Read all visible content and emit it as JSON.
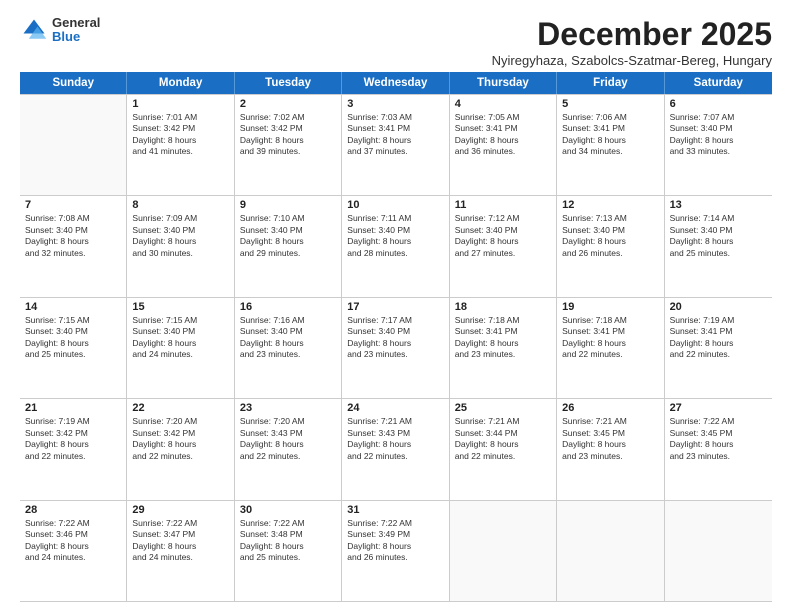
{
  "header": {
    "logo": {
      "general": "General",
      "blue": "Blue"
    },
    "title": "December 2025",
    "subtitle": "Nyiregyhaza, Szabolcs-Szatmar-Bereg, Hungary"
  },
  "weekdays": [
    "Sunday",
    "Monday",
    "Tuesday",
    "Wednesday",
    "Thursday",
    "Friday",
    "Saturday"
  ],
  "weeks": [
    [
      {
        "day": "",
        "lines": [],
        "empty": true
      },
      {
        "day": "1",
        "lines": [
          "Sunrise: 7:01 AM",
          "Sunset: 3:42 PM",
          "Daylight: 8 hours",
          "and 41 minutes."
        ],
        "empty": false
      },
      {
        "day": "2",
        "lines": [
          "Sunrise: 7:02 AM",
          "Sunset: 3:42 PM",
          "Daylight: 8 hours",
          "and 39 minutes."
        ],
        "empty": false
      },
      {
        "day": "3",
        "lines": [
          "Sunrise: 7:03 AM",
          "Sunset: 3:41 PM",
          "Daylight: 8 hours",
          "and 37 minutes."
        ],
        "empty": false
      },
      {
        "day": "4",
        "lines": [
          "Sunrise: 7:05 AM",
          "Sunset: 3:41 PM",
          "Daylight: 8 hours",
          "and 36 minutes."
        ],
        "empty": false
      },
      {
        "day": "5",
        "lines": [
          "Sunrise: 7:06 AM",
          "Sunset: 3:41 PM",
          "Daylight: 8 hours",
          "and 34 minutes."
        ],
        "empty": false
      },
      {
        "day": "6",
        "lines": [
          "Sunrise: 7:07 AM",
          "Sunset: 3:40 PM",
          "Daylight: 8 hours",
          "and 33 minutes."
        ],
        "empty": false
      }
    ],
    [
      {
        "day": "7",
        "lines": [
          "Sunrise: 7:08 AM",
          "Sunset: 3:40 PM",
          "Daylight: 8 hours",
          "and 32 minutes."
        ],
        "empty": false
      },
      {
        "day": "8",
        "lines": [
          "Sunrise: 7:09 AM",
          "Sunset: 3:40 PM",
          "Daylight: 8 hours",
          "and 30 minutes."
        ],
        "empty": false
      },
      {
        "day": "9",
        "lines": [
          "Sunrise: 7:10 AM",
          "Sunset: 3:40 PM",
          "Daylight: 8 hours",
          "and 29 minutes."
        ],
        "empty": false
      },
      {
        "day": "10",
        "lines": [
          "Sunrise: 7:11 AM",
          "Sunset: 3:40 PM",
          "Daylight: 8 hours",
          "and 28 minutes."
        ],
        "empty": false
      },
      {
        "day": "11",
        "lines": [
          "Sunrise: 7:12 AM",
          "Sunset: 3:40 PM",
          "Daylight: 8 hours",
          "and 27 minutes."
        ],
        "empty": false
      },
      {
        "day": "12",
        "lines": [
          "Sunrise: 7:13 AM",
          "Sunset: 3:40 PM",
          "Daylight: 8 hours",
          "and 26 minutes."
        ],
        "empty": false
      },
      {
        "day": "13",
        "lines": [
          "Sunrise: 7:14 AM",
          "Sunset: 3:40 PM",
          "Daylight: 8 hours",
          "and 25 minutes."
        ],
        "empty": false
      }
    ],
    [
      {
        "day": "14",
        "lines": [
          "Sunrise: 7:15 AM",
          "Sunset: 3:40 PM",
          "Daylight: 8 hours",
          "and 25 minutes."
        ],
        "empty": false
      },
      {
        "day": "15",
        "lines": [
          "Sunrise: 7:15 AM",
          "Sunset: 3:40 PM",
          "Daylight: 8 hours",
          "and 24 minutes."
        ],
        "empty": false
      },
      {
        "day": "16",
        "lines": [
          "Sunrise: 7:16 AM",
          "Sunset: 3:40 PM",
          "Daylight: 8 hours",
          "and 23 minutes."
        ],
        "empty": false
      },
      {
        "day": "17",
        "lines": [
          "Sunrise: 7:17 AM",
          "Sunset: 3:40 PM",
          "Daylight: 8 hours",
          "and 23 minutes."
        ],
        "empty": false
      },
      {
        "day": "18",
        "lines": [
          "Sunrise: 7:18 AM",
          "Sunset: 3:41 PM",
          "Daylight: 8 hours",
          "and 23 minutes."
        ],
        "empty": false
      },
      {
        "day": "19",
        "lines": [
          "Sunrise: 7:18 AM",
          "Sunset: 3:41 PM",
          "Daylight: 8 hours",
          "and 22 minutes."
        ],
        "empty": false
      },
      {
        "day": "20",
        "lines": [
          "Sunrise: 7:19 AM",
          "Sunset: 3:41 PM",
          "Daylight: 8 hours",
          "and 22 minutes."
        ],
        "empty": false
      }
    ],
    [
      {
        "day": "21",
        "lines": [
          "Sunrise: 7:19 AM",
          "Sunset: 3:42 PM",
          "Daylight: 8 hours",
          "and 22 minutes."
        ],
        "empty": false
      },
      {
        "day": "22",
        "lines": [
          "Sunrise: 7:20 AM",
          "Sunset: 3:42 PM",
          "Daylight: 8 hours",
          "and 22 minutes."
        ],
        "empty": false
      },
      {
        "day": "23",
        "lines": [
          "Sunrise: 7:20 AM",
          "Sunset: 3:43 PM",
          "Daylight: 8 hours",
          "and 22 minutes."
        ],
        "empty": false
      },
      {
        "day": "24",
        "lines": [
          "Sunrise: 7:21 AM",
          "Sunset: 3:43 PM",
          "Daylight: 8 hours",
          "and 22 minutes."
        ],
        "empty": false
      },
      {
        "day": "25",
        "lines": [
          "Sunrise: 7:21 AM",
          "Sunset: 3:44 PM",
          "Daylight: 8 hours",
          "and 22 minutes."
        ],
        "empty": false
      },
      {
        "day": "26",
        "lines": [
          "Sunrise: 7:21 AM",
          "Sunset: 3:45 PM",
          "Daylight: 8 hours",
          "and 23 minutes."
        ],
        "empty": false
      },
      {
        "day": "27",
        "lines": [
          "Sunrise: 7:22 AM",
          "Sunset: 3:45 PM",
          "Daylight: 8 hours",
          "and 23 minutes."
        ],
        "empty": false
      }
    ],
    [
      {
        "day": "28",
        "lines": [
          "Sunrise: 7:22 AM",
          "Sunset: 3:46 PM",
          "Daylight: 8 hours",
          "and 24 minutes."
        ],
        "empty": false
      },
      {
        "day": "29",
        "lines": [
          "Sunrise: 7:22 AM",
          "Sunset: 3:47 PM",
          "Daylight: 8 hours",
          "and 24 minutes."
        ],
        "empty": false
      },
      {
        "day": "30",
        "lines": [
          "Sunrise: 7:22 AM",
          "Sunset: 3:48 PM",
          "Daylight: 8 hours",
          "and 25 minutes."
        ],
        "empty": false
      },
      {
        "day": "31",
        "lines": [
          "Sunrise: 7:22 AM",
          "Sunset: 3:49 PM",
          "Daylight: 8 hours",
          "and 26 minutes."
        ],
        "empty": false
      },
      {
        "day": "",
        "lines": [],
        "empty": true
      },
      {
        "day": "",
        "lines": [],
        "empty": true
      },
      {
        "day": "",
        "lines": [],
        "empty": true
      }
    ]
  ]
}
